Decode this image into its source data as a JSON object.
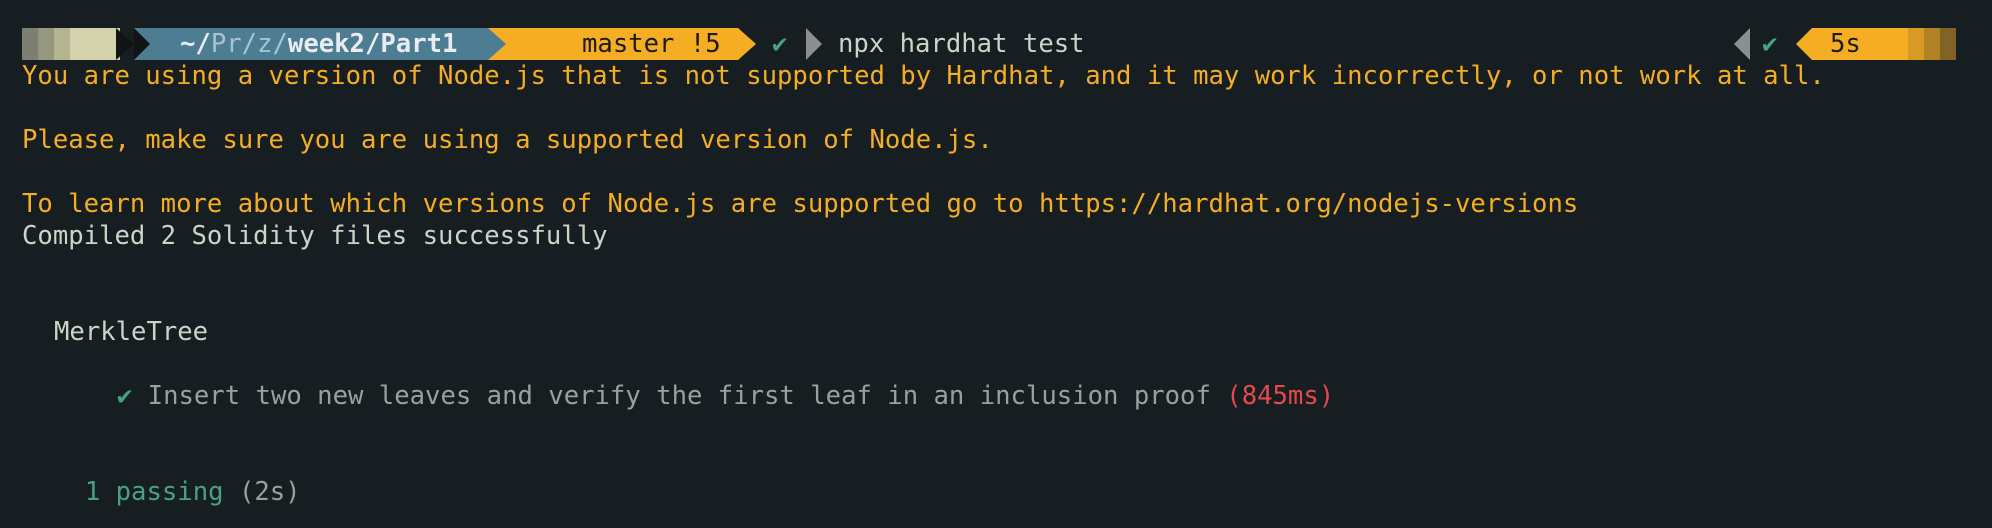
{
  "prompt": {
    "path_home": "~/",
    "path_pr": "Pr",
    "path_sep1": "/",
    "path_z": "z",
    "path_sep2": "/",
    "path_week": "week2",
    "path_sep3": "/",
    "path_part": "Part1",
    "branch": "master !5",
    "status_check": "✔",
    "command": "npx hardhat test",
    "right_check": "✔",
    "duration": "5s",
    "colors": {
      "path_bg": "#4d7d93",
      "git_bg": "#f5ad24",
      "check": "#4aa084",
      "arrow": "#8b8f8f"
    }
  },
  "output": {
    "warning_1": "You are using a version of Node.js that is not supported by Hardhat, and it may work incorrectly, or not work at all.",
    "warning_2": "Please, make sure you are using a supported version of Node.js.",
    "warning_3": "To learn more about which versions of Node.js are supported go to https://hardhat.org/nodejs-versions",
    "compiled": "Compiled 2 Solidity files successfully",
    "suite_name": "MerkleTree",
    "test_check": "✔",
    "test_name": "Insert two new leaves and verify the first leaf in an inclusion proof",
    "test_time": "(845ms)",
    "passing_count": "1 passing",
    "passing_time": "(2s)"
  }
}
